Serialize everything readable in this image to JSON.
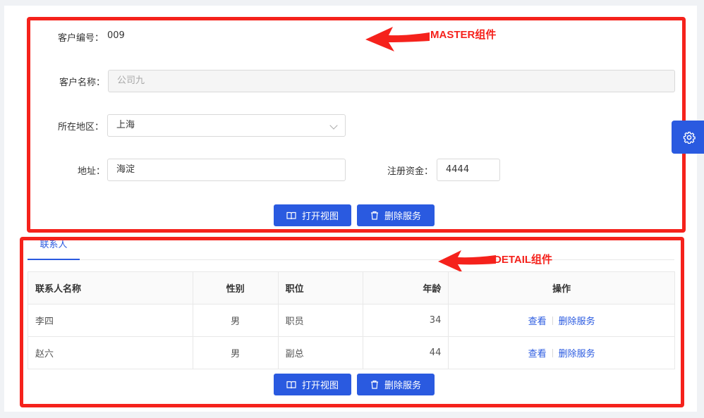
{
  "master": {
    "customer_no": {
      "label": "客户编号：",
      "value": "009"
    },
    "customer_name": {
      "label": "客户名称：",
      "value": "公司九"
    },
    "region": {
      "label": "所在地区：",
      "value": "上海"
    },
    "address": {
      "label": "地址：",
      "value": "海淀"
    },
    "capital": {
      "label": "注册资金：",
      "value": "4444"
    },
    "buttons": {
      "open_view": "打开视图",
      "delete_service": "删除服务"
    }
  },
  "annotations": {
    "master": "MASTER组件",
    "detail": "DETAIL组件"
  },
  "detail": {
    "tab": "联系人",
    "columns": [
      "联系人名称",
      "性别",
      "职位",
      "年龄",
      "操作"
    ],
    "rows": [
      {
        "name": "李四",
        "gender": "男",
        "position": "职员",
        "age": "34",
        "view": "查看",
        "delete": "删除服务"
      },
      {
        "name": "赵六",
        "gender": "男",
        "position": "副总",
        "age": "44",
        "view": "查看",
        "delete": "删除服务"
      }
    ],
    "buttons": {
      "open_view": "打开视图",
      "delete_service": "删除服务"
    }
  },
  "colors": {
    "accent": "#2a5ae0",
    "annotation_red": "#f5221c"
  },
  "icons": {
    "settings": "gear-icon",
    "view": "book-icon",
    "delete": "trash-icon"
  }
}
